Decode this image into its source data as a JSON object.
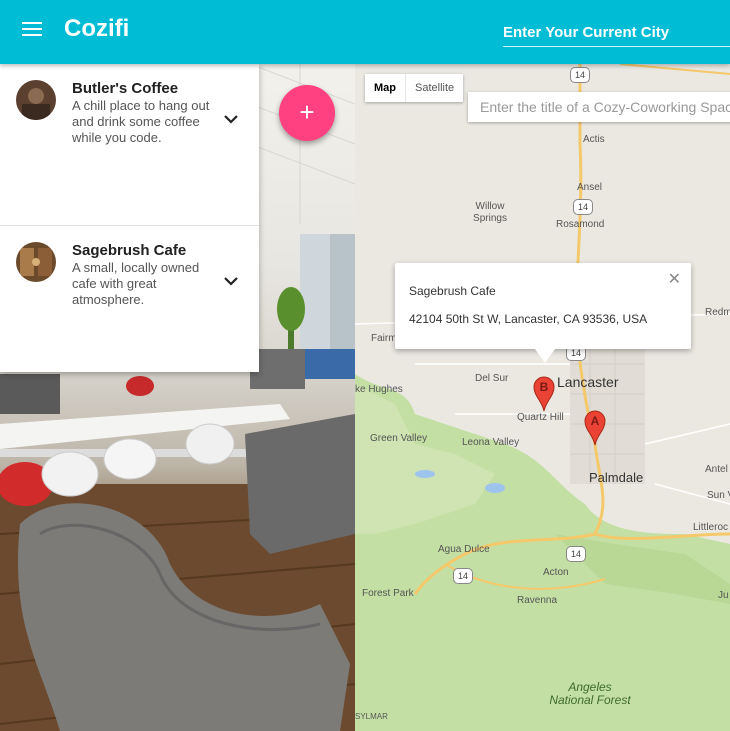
{
  "app": {
    "title": "Cozifi",
    "city_placeholder": "Enter Your Current City"
  },
  "places": [
    {
      "name": "Butler's Coffee",
      "description": "A chill place to hang out and drink some coffee while you code."
    },
    {
      "name": "Sagebrush Cafe",
      "description": "A small, locally owned cafe with great atmosphere."
    }
  ],
  "fab": {
    "label": "+"
  },
  "map": {
    "type_map": "Map",
    "type_satellite": "Satellite",
    "search_placeholder": "Enter the title of a Cozy-Coworking Space",
    "info_window": {
      "title": "Sagebrush Cafe",
      "address": "42104 50th St W, Lancaster, CA 93536, USA",
      "close": "✕"
    },
    "markers": [
      {
        "label": "A"
      },
      {
        "label": "B"
      }
    ],
    "places": [
      "Actis",
      "Ansel",
      "Willow Springs",
      "Rosamond",
      "Redm",
      "Fairm",
      "Lancaster",
      "Del Sur",
      "ke Hughes",
      "Quartz Hill",
      "Green Valley",
      "Leona Valley",
      "Palmdale",
      "Antel",
      "Sun V",
      "Littleroc",
      "Agua Dulce",
      "Acton",
      "Forest Park",
      "Ravenna",
      "Ju"
    ],
    "highway": "14",
    "forest_line1": "Angeles",
    "forest_line2": "National Forest",
    "corner": "SYLMAR"
  },
  "colors": {
    "appbar": "#00bcd4",
    "fab": "#ff4081",
    "marker": "#ea4335",
    "forest": "#c4dfa4"
  }
}
